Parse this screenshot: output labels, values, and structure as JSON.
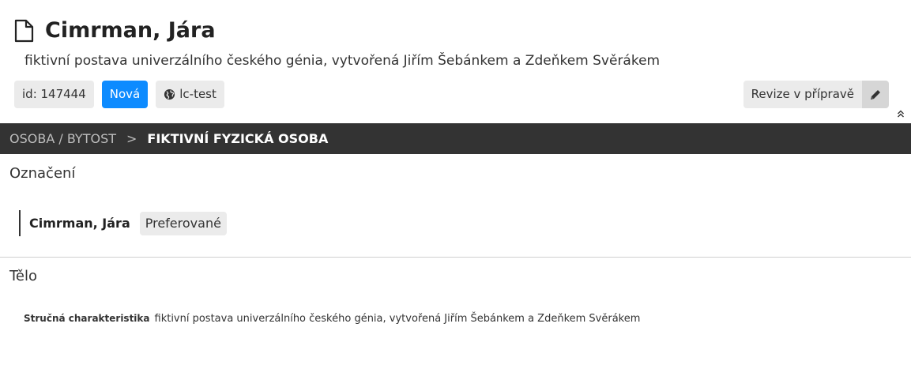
{
  "header": {
    "title": "Cimrman, Jára",
    "subtitle": "fiktivní postava univerzálního českého génia, vytvořená Jiřím Šebánkem a Zdeňkem Svěrákem",
    "badges": {
      "id": "id: 147444",
      "status": "Nová",
      "instance": "lc-test"
    },
    "revision_label": "Revize v přípravě",
    "status_color": "#0d8bff",
    "icons": {
      "document": "document-icon",
      "globe": "globe-icon",
      "edit": "pencil-icon",
      "collapse": "chevrons-up-icon"
    }
  },
  "breadcrumb": {
    "parent": "OSOBA / BYTOST",
    "separator": ">",
    "current": "FIKTIVNÍ FYZICKÁ OSOBA"
  },
  "sections": {
    "designation": {
      "title": "Označení",
      "entry_name": "Cimrman, Jára",
      "entry_tag": "Preferované"
    },
    "body": {
      "title": "Tělo",
      "characteristic_label": "Stručná charakteristika",
      "characteristic_value": "fiktivní postava univerzálního českého génia, vytvořená Jiřím Šebánkem a Zdeňkem Svěrákem"
    }
  }
}
